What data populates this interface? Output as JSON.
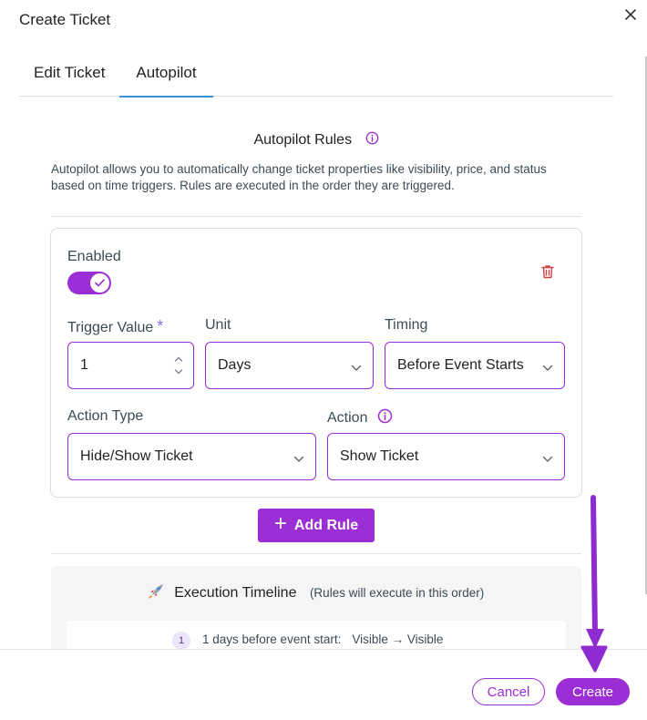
{
  "dialog": {
    "title": "Create Ticket"
  },
  "tabs": [
    {
      "label": "Edit Ticket"
    },
    {
      "label": "Autopilot"
    }
  ],
  "autopilot": {
    "title": "Autopilot Rules",
    "description": "Autopilot allows you to automatically change ticket properties like visibility, price, and status based on time triggers. Rules are executed in the order they are triggered."
  },
  "rule": {
    "enabled_label": "Enabled",
    "enabled": true,
    "trigger_value_label": "Trigger Value",
    "required_mark": "*",
    "trigger_value": "1",
    "unit_label": "Unit",
    "unit_value": "Days",
    "timing_label": "Timing",
    "timing_value": "Before Event Starts",
    "action_type_label": "Action Type",
    "action_type_value": "Hide/Show Ticket",
    "action_label": "Action",
    "action_value": "Show Ticket"
  },
  "add_rule": {
    "label": "Add Rule"
  },
  "timeline": {
    "title": "Execution Timeline",
    "subtitle": "(Rules will execute in this order)",
    "items": [
      {
        "number": "1",
        "text": "1 days before event start:",
        "change": "Visible → Visible"
      }
    ]
  },
  "footer": {
    "cancel_label": "Cancel",
    "create_label": "Create"
  },
  "colors": {
    "accent": "#9b2ed4",
    "tab_underline": "#3b8fd4",
    "annotation_arrow": "#8e2bd1"
  },
  "icons": [
    "close-icon",
    "info-icon",
    "check-icon",
    "trash-icon",
    "stepper-icon",
    "chevron-down-icon",
    "plus-icon",
    "rocket-icon"
  ]
}
